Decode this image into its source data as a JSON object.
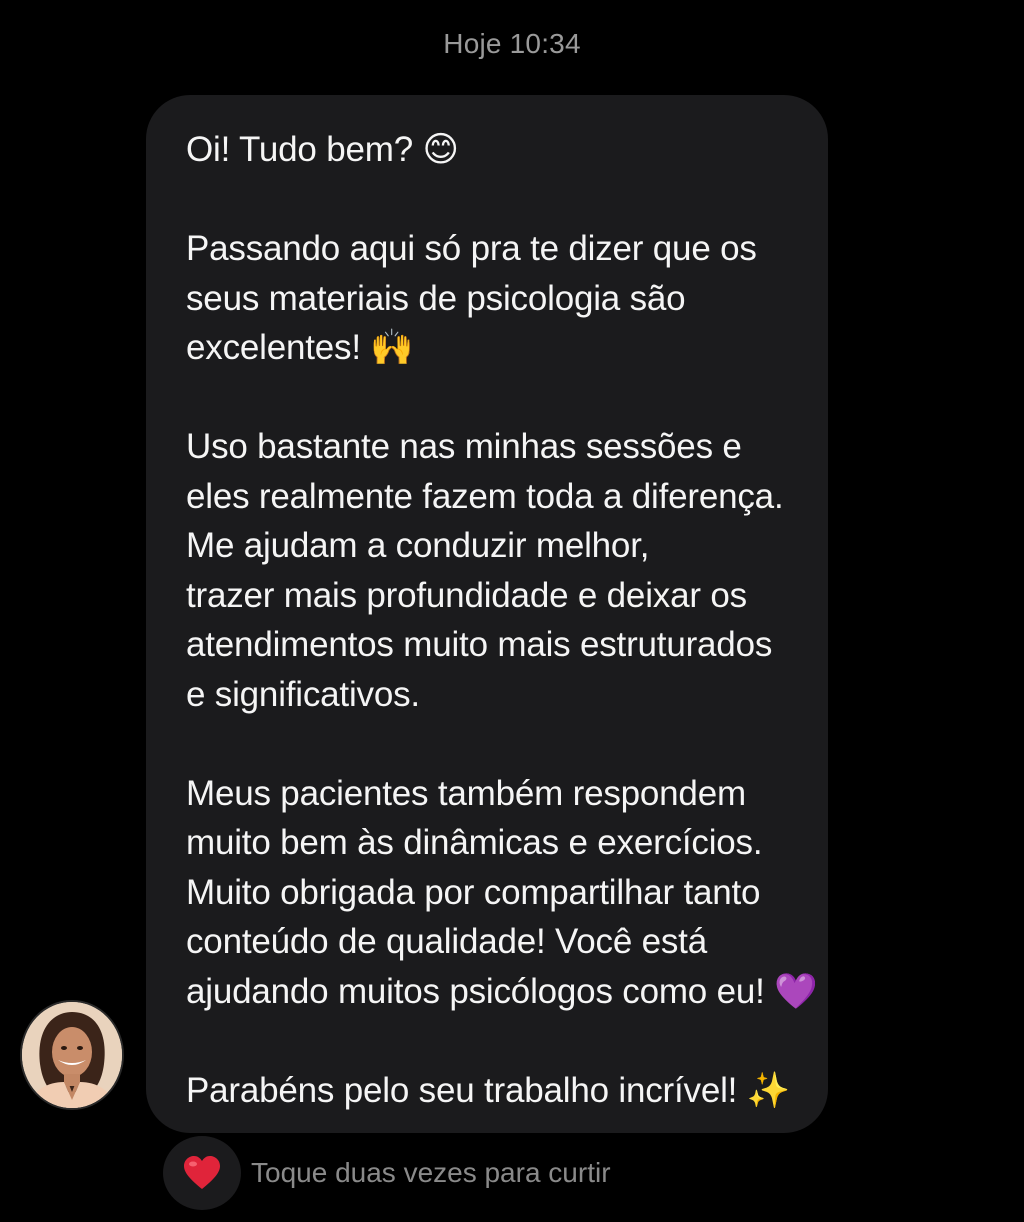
{
  "header": {
    "timestamp": "Hoje 10:34"
  },
  "message": {
    "greeting": "Oi! Tudo bem? 😊",
    "paragraph1": [
      "Passando aqui só pra te dizer que os",
      "seus materiais de psicologia são",
      "excelentes! 🙌"
    ],
    "paragraph2": [
      "Uso bastante nas minhas sessões e",
      "eles realmente fazem toda a diferença.",
      "Me ajudam a conduzir melhor,",
      "trazer mais profundidade e deixar os",
      "atendimentos muito mais estruturados",
      "e significativos."
    ],
    "paragraph3": [
      "Meus pacientes também respondem",
      "muito bem às dinâmicas e exercícios.",
      "Muito obrigada por compartilhar tanto",
      "conteúdo de qualidade! Você está",
      "ajudando muitos psicólogos como eu! 💜"
    ],
    "closing": "Parabéns pelo seu trabalho incrível! ✨"
  },
  "reaction": {
    "emoji": "❤️",
    "hint": "Toque duas vezes para curtir"
  },
  "colors": {
    "background": "#000000",
    "bubble": "#1b1b1d",
    "text": "#f5f5f5",
    "muted": "#9a9a9a",
    "heart": "#e0243a"
  },
  "icons": {
    "avatar": "avatar-photo",
    "heart": "heart-icon"
  }
}
